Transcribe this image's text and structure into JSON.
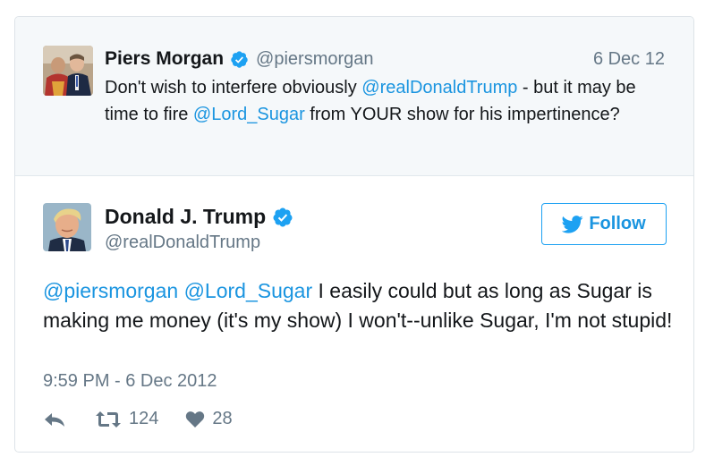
{
  "quoted_tweet": {
    "author_name": "Piers Morgan",
    "handle": "@piersmorgan",
    "date": "6 Dec 12",
    "text_parts": {
      "p1": "Don't wish to interfere obviously ",
      "m1": "@realDonaldTrump",
      "p2": " - but it may be time to fire ",
      "m2": "@Lord_Sugar",
      "p3": " from YOUR show for his impertinence?"
    }
  },
  "main_tweet": {
    "author_name": "Donald J. Trump",
    "handle": "@realDonaldTrump",
    "follow_label": "Follow",
    "text_parts": {
      "m1": "@piersmorgan",
      "sp": " ",
      "m2": "@Lord_Sugar",
      "p1": " I easily could but as long as Sugar is making me money (it's my show) I won't--unlike Sugar, I'm not stupid!"
    },
    "timestamp": "9:59 PM - 6 Dec 2012",
    "retweet_count": "124",
    "like_count": "28"
  },
  "colors": {
    "accent": "#1da1f2",
    "link": "#1b95e0",
    "secondary_text": "#657786",
    "quoted_bg": "#f5f8fa"
  },
  "icons": [
    "verified-badge-icon",
    "twitter-bird-icon",
    "reply-icon",
    "retweet-icon",
    "heart-icon"
  ]
}
